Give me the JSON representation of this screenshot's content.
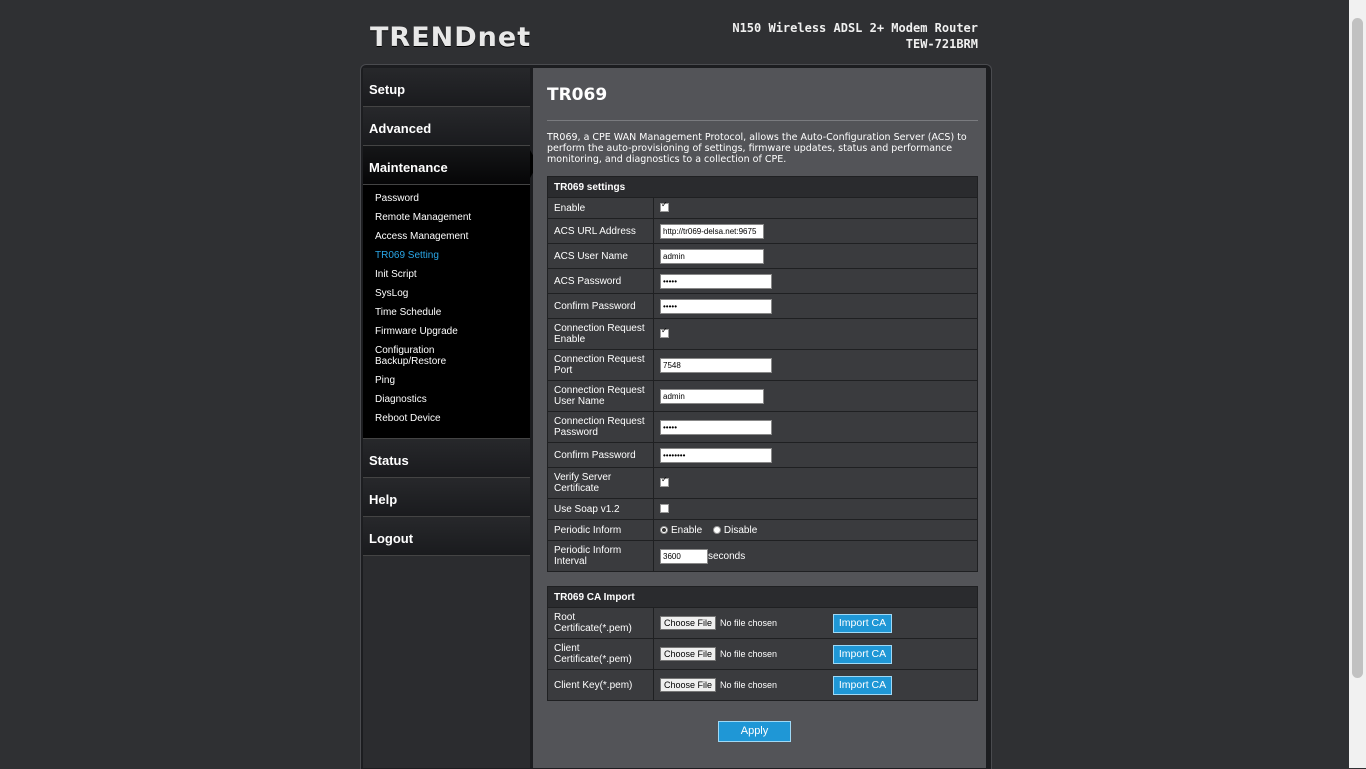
{
  "header": {
    "brand": "TRENDnet",
    "product_name": "N150 Wireless ADSL 2+ Modem Router",
    "model": "TEW-721BRM"
  },
  "sidebar": {
    "sections": [
      {
        "label": "Setup"
      },
      {
        "label": "Advanced"
      },
      {
        "label": "Maintenance"
      },
      {
        "label": "Status"
      },
      {
        "label": "Help"
      },
      {
        "label": "Logout"
      }
    ],
    "maintenance_items": [
      "Password",
      "Remote Management",
      "Access Management",
      "TR069 Setting",
      "Init Script",
      "SysLog",
      "Time Schedule",
      "Firmware Upgrade",
      "Configuration Backup/Restore",
      "Ping",
      "Diagnostics",
      "Reboot Device"
    ],
    "current_item": "TR069 Setting"
  },
  "main": {
    "title": "TR069",
    "description": "TR069, a CPE WAN Management Protocol, allows the Auto-Configuration Server (ACS) to perform the auto-provisioning of settings, firmware updates, status and performance monitoring, and diagnostics to a collection of CPE.",
    "settings": {
      "header": "TR069 settings",
      "enable_label": "Enable",
      "enable_checked": true,
      "acs_url_label": "ACS URL Address",
      "acs_url_value": "http://tr069-delsa.net:9675",
      "acs_user_label": "ACS User Name",
      "acs_user_value": "admin",
      "acs_password_label": "ACS Password",
      "acs_password_value": "•••••",
      "confirm_password_label": "Confirm Password",
      "confirm_password_value": "•••••",
      "conn_req_enable_label": "Connection Request Enable",
      "conn_req_enable_checked": true,
      "conn_req_port_label": "Connection Request Port",
      "conn_req_port_value": "7548",
      "conn_req_user_label": "Connection Request User Name",
      "conn_req_user_value": "admin",
      "conn_req_password_label": "Connection Request Password",
      "conn_req_password_value": "•••••",
      "conn_req_confirm_label": "Confirm Password",
      "conn_req_confirm_value": "••••••••",
      "verify_cert_label": "Verify Server Certificate",
      "verify_cert_checked": true,
      "use_soap_label": "Use Soap v1.2",
      "use_soap_checked": false,
      "periodic_inform_label": "Periodic Inform",
      "periodic_enable_label": "Enable",
      "periodic_disable_label": "Disable",
      "periodic_inform_selected": "Enable",
      "periodic_interval_label": "Periodic Inform Interval",
      "periodic_interval_value": "3600",
      "periodic_interval_unit": "seconds"
    },
    "ca_import": {
      "header": "TR069 CA Import",
      "choose_file_label": "Choose File",
      "no_file_text": "No file chosen",
      "import_label": "Import CA",
      "rows": [
        {
          "label": "Root Certificate(*.pem)"
        },
        {
          "label": "Client Certificate(*.pem)"
        },
        {
          "label": "Client Key(*.pem)"
        }
      ]
    },
    "apply_label": "Apply"
  },
  "colors": {
    "accent": "#1f97d6",
    "current_nav": "#2aa7e8",
    "page_bg": "#2f3033",
    "content_bg": "#535458"
  }
}
